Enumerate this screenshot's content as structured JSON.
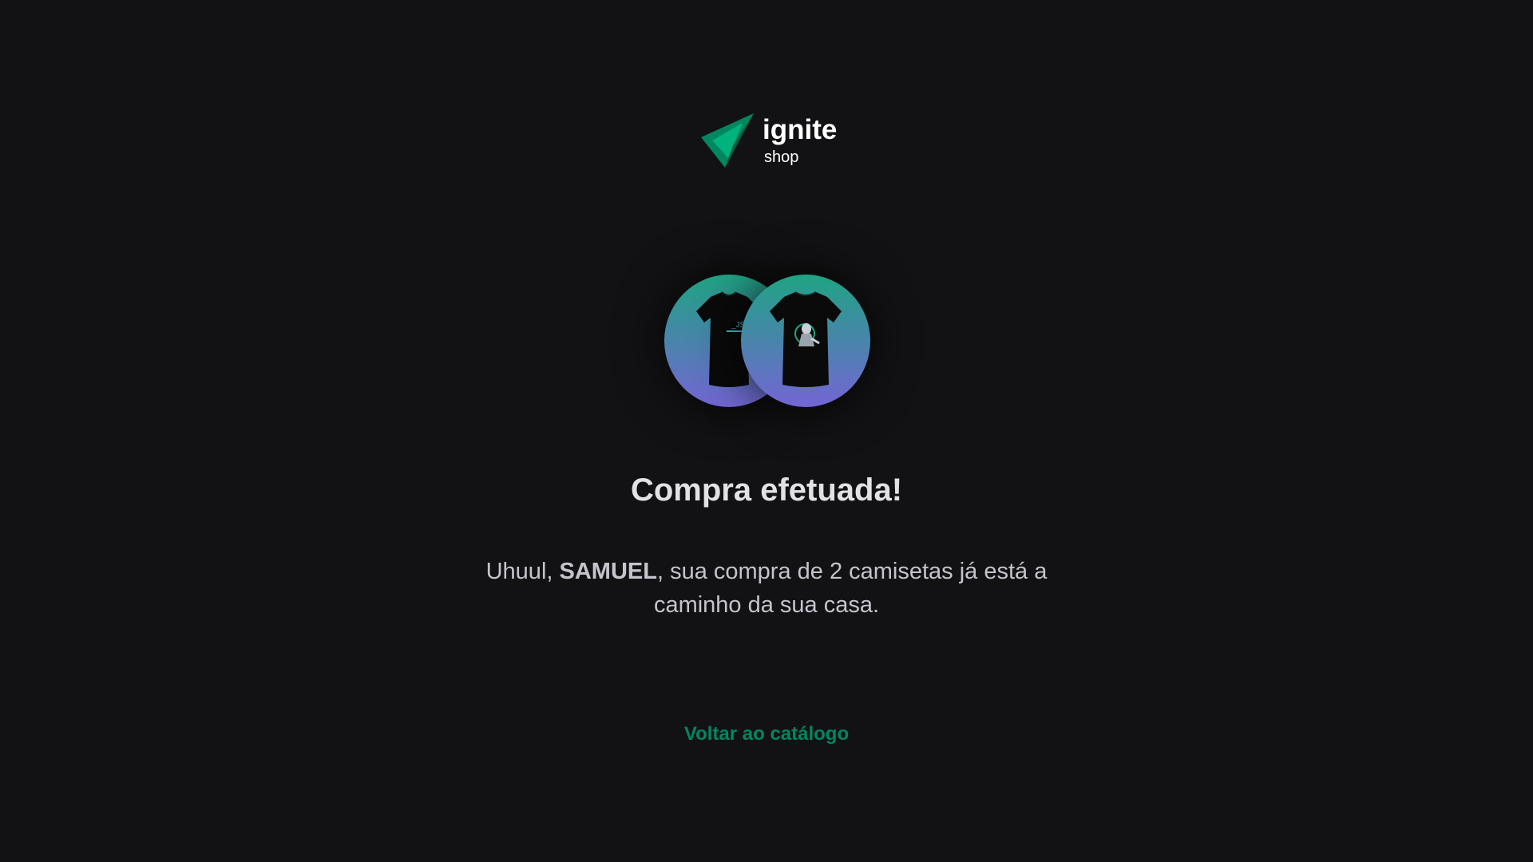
{
  "brand": {
    "title": "ignite",
    "subtitle": "shop",
    "logo_icon": "ignite-logo-icon",
    "colors": {
      "mark_dark": "#00875f",
      "mark_light": "#00b37e"
    }
  },
  "products": [
    {
      "icon": "tshirt-image",
      "print_color": "#4ec8d6"
    },
    {
      "icon": "tshirt-image",
      "print_color": "#c8d0d8"
    }
  ],
  "success": {
    "title": "Compra efetuada!",
    "message_prefix": "Uhuul, ",
    "customer_name": "SAMUEL",
    "message_suffix": ", sua compra de 2 camisetas já está a caminho da sua casa."
  },
  "actions": {
    "back_label": "Voltar ao catálogo",
    "accent_color": "#00875f"
  },
  "theme": {
    "background": "#121214",
    "gradient_top": "#1ea483",
    "gradient_bottom": "#7465d4"
  }
}
